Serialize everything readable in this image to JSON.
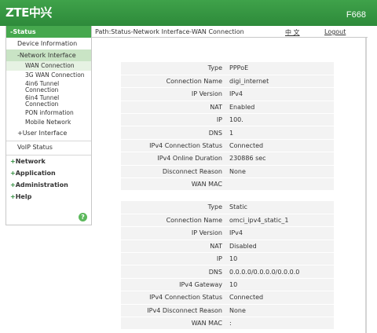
{
  "header": {
    "logo": "ZTE中兴",
    "model": "F668"
  },
  "breadcrumb": {
    "path": "Path:Status-Network Interface-WAN Connection",
    "lang": "中 文",
    "logout": "Logout"
  },
  "sidebar": {
    "status": "-Status",
    "device_info": "Device Information",
    "network_interface": "-Network Interface",
    "wan_connection": "WAN Connection",
    "wan_3g": "3G WAN Connection",
    "tunnel_4in6": "4in6 Tunnel Connection",
    "tunnel_6in4": "6in4 Tunnel Connection",
    "pon_info": "PON information",
    "mobile_network": "Mobile Network",
    "user_interface": "User Interface",
    "voip_status": "VoIP Status",
    "network": "Network",
    "application": "Application",
    "administration": "Administration",
    "help": "Help",
    "help_icon": "?"
  },
  "connection_1": {
    "type_label": "Type",
    "type": "PPPoE",
    "name_label": "Connection Name",
    "name": "digi_internet",
    "ipver_label": "IP Version",
    "ipver": "IPv4",
    "nat_label": "NAT",
    "nat": "Enabled",
    "ip_label": "IP",
    "ip": "100.",
    "dns_label": "DNS",
    "dns": "1",
    "status_label": "IPv4 Connection Status",
    "status": "Connected",
    "duration_label": "IPv4 Online Duration",
    "duration": "230886 sec",
    "disc_label": "Disconnect Reason",
    "disc": "None",
    "mac_label": "WAN MAC",
    "mac": ""
  },
  "connection_2": {
    "type_label": "Type",
    "type": "Static",
    "name_label": "Connection Name",
    "name": "omci_ipv4_static_1",
    "ipver_label": "IP Version",
    "ipver": "IPv4",
    "nat_label": "NAT",
    "nat": "Disabled",
    "ip_label": "IP",
    "ip": "10",
    "dns_label": "DNS",
    "dns": "0.0.0.0/0.0.0.0/0.0.0.0",
    "gw_label": "IPv4 Gateway",
    "gw": "10",
    "status_label": "IPv4 Connection Status",
    "status": "Connected",
    "disc_label": "IPv4 Disconnect Reason",
    "disc": "None",
    "mac_label": "WAN MAC",
    "mac": ":"
  },
  "colors": {
    "header_green": "#3fa24a",
    "menu_active": "#46a84e",
    "table_bg": "#f3f3f3"
  }
}
